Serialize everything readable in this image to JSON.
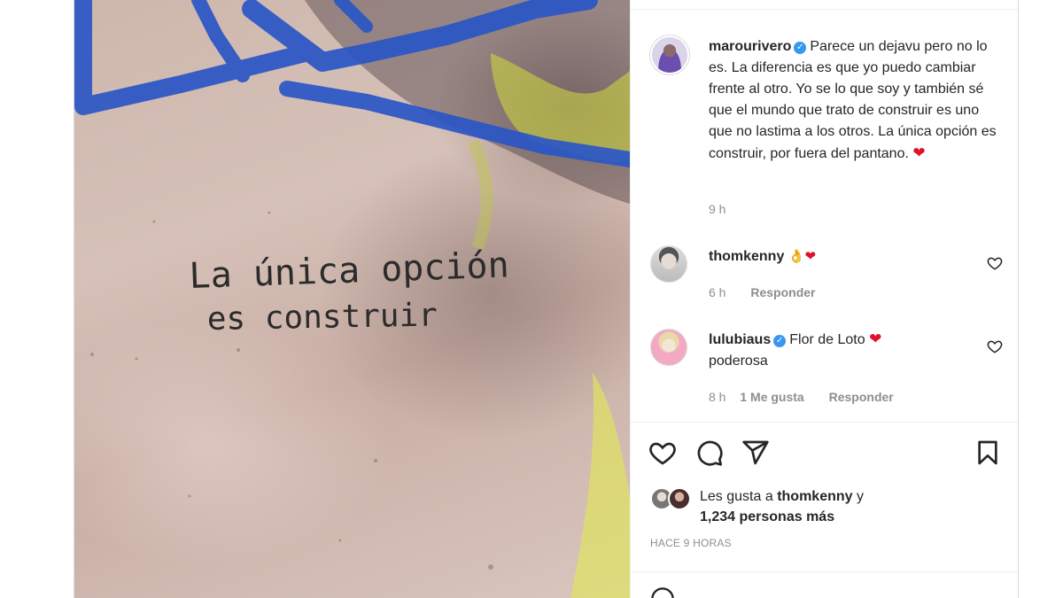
{
  "post_image": {
    "handwriting_line1": "La única opción",
    "handwriting_line2": "es construir"
  },
  "caption": {
    "username": "marourivero",
    "verified_badge": "verified-badge",
    "text": "Parece un dejavu pero no lo es. La diferencia es que yo puedo cambiar frente al otro. Yo se lo que soy y también sé que el mundo que trato de construir es uno que no lastima a los otros. La única opción es construir, por fuera del pantano.",
    "emoji": "❤",
    "time": "9 h"
  },
  "comments": [
    {
      "username": "thomkenny",
      "text": "👌❤",
      "time": "6 h",
      "likes": "",
      "reply_label": "Responder",
      "verified": false
    },
    {
      "username": "lulubiaus",
      "text": "Flor de Loto",
      "emoji": "❤",
      "text_line2": "poderosa",
      "time": "8 h",
      "likes": "1 Me gusta",
      "reply_label": "Responder",
      "verified": true
    }
  ],
  "actions": [
    "heart-icon",
    "comment-icon",
    "share-icon",
    "bookmark-icon"
  ],
  "likes": {
    "prefix": "Les gusta a",
    "user": "thomkenny",
    "joiner": "y",
    "others": "1,234 personas más"
  },
  "timestamp": "HACE 9 HORAS",
  "colors": {
    "verified": "#3897f0",
    "heart": "#e0112b",
    "muted": "#8e8e8e",
    "text": "#262626"
  }
}
